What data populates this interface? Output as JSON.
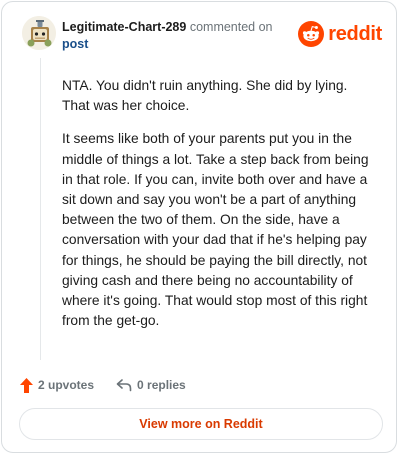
{
  "header": {
    "username": "Legitimate-Chart-289",
    "commented_on": "commented on",
    "post_link": "post",
    "logo_text": "reddit",
    "avatar_icon": "snoo-avatar-icon",
    "logo_icon": "reddit-snoo-icon"
  },
  "comment": {
    "paragraphs": [
      "NTA. You didn't ruin anything. She did by lying. That was her choice.",
      "It seems like both of your parents put you in the middle of things a lot. Take a step back from being in that role. If you can, invite both over and have a sit down and say you won't be a part of anything between the two of them. On the side, have a conversation with your dad that if he's helping pay for things, he should be paying the bill directly, not giving cash and there being no accountability of where it's going. That would stop most of this right from the get-go."
    ]
  },
  "actions": {
    "upvotes_label": "2 upvotes",
    "replies_label": "0 replies",
    "upvote_icon": "upvote-arrow-icon",
    "reply_icon": "reply-arrow-icon"
  },
  "footer": {
    "view_button": "View more on Reddit"
  },
  "colors": {
    "brand": "#ff4500",
    "link": "#1a4f8a",
    "muted": "#6b7378",
    "button_text": "#d93a00"
  }
}
